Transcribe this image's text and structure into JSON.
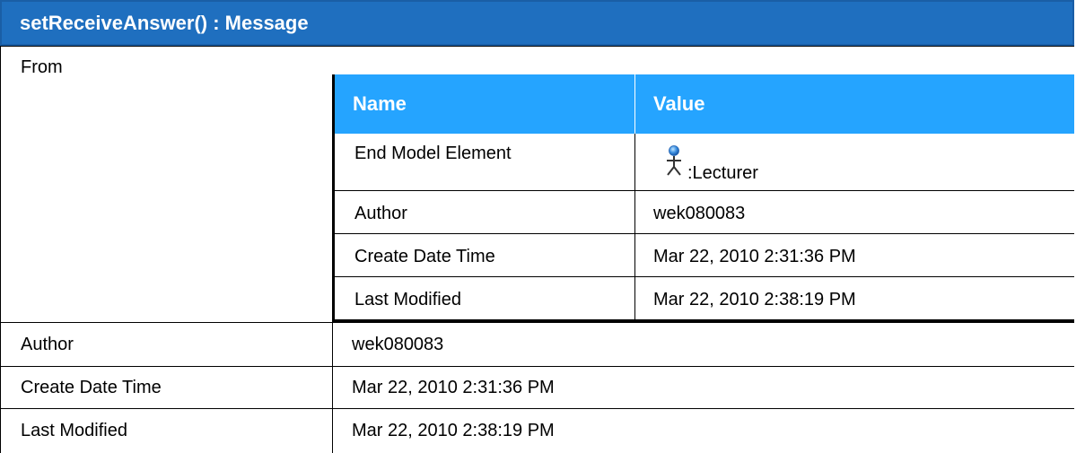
{
  "title": "setReceiveAnswer() : Message",
  "rows": [
    {
      "label": "From"
    },
    {
      "label": "Author",
      "value": "wek080083"
    },
    {
      "label": "Create Date Time",
      "value": "Mar 22, 2010 2:31:36 PM"
    },
    {
      "label": "Last Modified",
      "value": "Mar 22, 2010 2:38:19 PM"
    }
  ],
  "nested": {
    "headers": {
      "name": "Name",
      "value": "Value"
    },
    "rows": [
      {
        "name": "End Model Element",
        "value": ":Lecturer",
        "icon": "actor-icon"
      },
      {
        "name": "Author",
        "value": "wek080083"
      },
      {
        "name": "Create Date Time",
        "value": "Mar 22, 2010 2:31:36 PM"
      },
      {
        "name": "Last Modified",
        "value": "Mar 22, 2010 2:38:19 PM"
      }
    ]
  },
  "colors": {
    "title_bar": "#1f6fbf",
    "header_row": "#25a4ff"
  }
}
